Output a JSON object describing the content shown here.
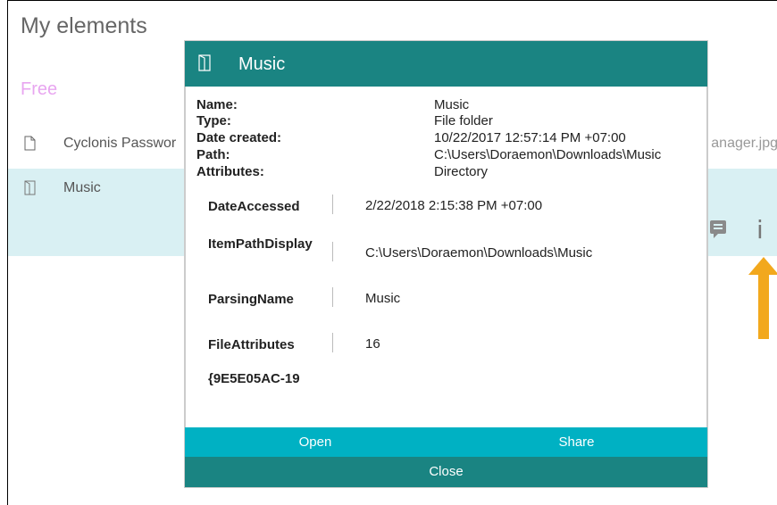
{
  "app": {
    "title": "My elements"
  },
  "section": {
    "label": "Free"
  },
  "list": {
    "items": [
      {
        "name": "Cyclonis Passwor",
        "file": "anager.jpg",
        "icon": "file-icon"
      },
      {
        "name": "Music",
        "icon": "folder-icon"
      }
    ]
  },
  "row_actions": {
    "comment_icon": "comment-icon",
    "info_icon": "info-icon",
    "info_glyph": "i"
  },
  "dialog": {
    "title": "Music",
    "icon": "folder-icon",
    "properties": [
      {
        "label": "Name:",
        "value": "Music"
      },
      {
        "label": "Type:",
        "value": "File folder"
      },
      {
        "label": "Date created:",
        "value": "10/22/2017 12:57:14 PM +07:00"
      },
      {
        "label": "Path:",
        "value": "C:\\Users\\Doraemon\\Downloads\\Music"
      },
      {
        "label": "Attributes:",
        "value": "Directory"
      }
    ],
    "details": [
      {
        "label": "DateAccessed",
        "value": "2/22/2018 2:15:38 PM +07:00"
      },
      {
        "label": "ItemPathDisplay",
        "value": "C:\\Users\\Doraemon\\Downloads\\Music"
      },
      {
        "label": "ParsingName",
        "value": "Music"
      },
      {
        "label": "FileAttributes",
        "value": "16"
      },
      {
        "label": "{9E5E05AC-19",
        "value": ""
      }
    ],
    "buttons": {
      "open": "Open",
      "share": "Share",
      "close": "Close"
    }
  },
  "colors": {
    "accent": "#1a8482",
    "button_bar": "#00b1c3",
    "selected_row": "#d9f0f3",
    "arrow": "#f2a81d",
    "free_label": "#e8a6f0"
  }
}
